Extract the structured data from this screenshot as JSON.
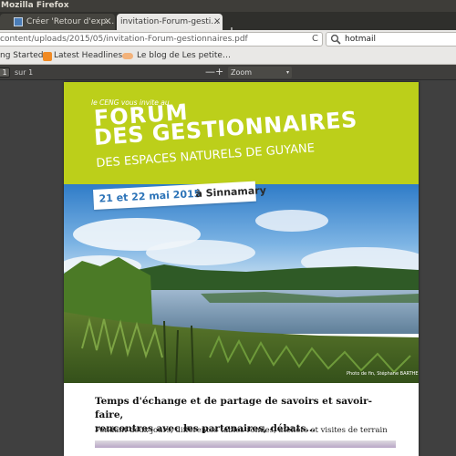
{
  "window": {
    "title": "Mozilla Firefox"
  },
  "tabs": [
    {
      "label": "Créer 'Retour d'exp…",
      "close": "×"
    },
    {
      "label": "invitation-Forum-gesti…",
      "close": "×"
    }
  ],
  "new_tab": "+",
  "address_bar": {
    "url": "content/uploads/2015/05/invitation-Forum-gestionnaires.pdf",
    "reload": "C"
  },
  "search_bar": {
    "value": "hotmail"
  },
  "bookmarks": [
    {
      "label": "ng Started"
    },
    {
      "label": "Latest Headlines ▾"
    },
    {
      "label": "Le blog de Les petite…"
    }
  ],
  "pdf_toolbar": {
    "page_number": "1",
    "page_of": "sur 1",
    "zoom_out": "—",
    "zoom_in": "+",
    "zoom_mode": "Zoom automatique",
    "zoom_caret": "▾"
  },
  "document": {
    "banner_invite": "le CENG vous invite au",
    "banner_title_line1": "FORUM",
    "banner_title_line2": "DES GESTIONNAIRES",
    "banner_subtitle": "DES ESPACES NATURELS DE GUYANE",
    "date": "21 et 22 mai 2015",
    "place": "à Sinnamary",
    "photo_credit": "Photo de fin, Stéphane BARTHE",
    "lead_line1": "Temps d'échange et de partage de savoirs et savoir-faire,",
    "lead_line2": "rencontres avec les partenaires, débats…",
    "body_line1": "Pendant deux jours, différentes tables rondes, ateliers et visites de terrain"
  },
  "colors": {
    "banner_green": "#bccf1a",
    "date_blue": "#2d74b8",
    "viewer_bg": "#404040"
  }
}
